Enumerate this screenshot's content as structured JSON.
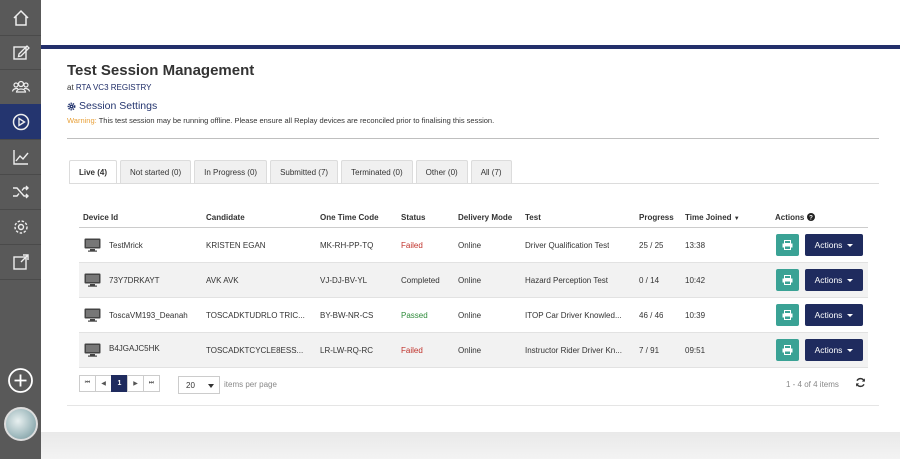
{
  "page": {
    "title": "Test Session Management",
    "subtitle_prefix": "at",
    "subtitle_registry": "RTA VC3 REGISTRY",
    "settings_label": "Session Settings",
    "warning_label": "Warning:",
    "warning_text": "This test session may be running offline. Please ensure all Replay devices are reconciled prior to finalising this session."
  },
  "sidebar": {
    "items": [
      {
        "icon": "home-icon"
      },
      {
        "icon": "edit-icon"
      },
      {
        "icon": "users-icon"
      },
      {
        "icon": "play-icon",
        "active": true
      },
      {
        "icon": "chart-icon"
      },
      {
        "icon": "shuffle-icon"
      },
      {
        "icon": "gear-icon"
      },
      {
        "icon": "external-link-icon"
      }
    ],
    "add_icon": "plus-circle-icon"
  },
  "tabs": [
    {
      "label": "Live (4)",
      "active": true
    },
    {
      "label": "Not started (0)"
    },
    {
      "label": "In Progress (0)"
    },
    {
      "label": "Submitted (7)"
    },
    {
      "label": "Terminated (0)"
    },
    {
      "label": "Other (0)"
    },
    {
      "label": "All (7)"
    }
  ],
  "table": {
    "headers": {
      "device": "Device Id",
      "candidate": "Candidate",
      "code": "One Time Code",
      "status": "Status",
      "mode": "Delivery Mode",
      "test": "Test",
      "progress": "Progress",
      "time": "Time Joined",
      "actions": "Actions"
    },
    "sort_indicator": "▼",
    "rows": [
      {
        "device": "TestMrick",
        "candidate": "KRISTEN EGAN",
        "code": "MK-RH-PP-TQ",
        "status": "Failed",
        "mode": "Online",
        "test": "Driver Qualification Test",
        "progress": "25 / 25",
        "time": "13:38",
        "actions": "Actions"
      },
      {
        "device": "73Y7DRKAYT",
        "candidate": "AVK AVK",
        "code": "VJ-DJ-BV-YL",
        "status": "Completed",
        "mode": "Online",
        "test": "Hazard Perception Test",
        "progress": "0 / 14",
        "time": "10:42",
        "actions": "Actions"
      },
      {
        "device": "ToscaVM193_Deanah",
        "candidate": "TOSCADKTUDRLO TRIC...",
        "code": "BY-BW-NR-CS",
        "status": "Passed",
        "mode": "Online",
        "test": "ITOP Car Driver Knowled...",
        "progress": "46 / 46",
        "time": "10:39",
        "actions": "Actions"
      },
      {
        "device": "B4JGAJC5HK",
        "candidate": "TOSCADKTCYCLE8ESS...",
        "code": "LR-LW-RQ-RC",
        "status": "Failed",
        "mode": "Online",
        "test": "Instructor Rider Driver Kn...",
        "progress": "7 / 91",
        "time": "09:51",
        "actions": "Actions"
      }
    ]
  },
  "pagination": {
    "first": "⏮",
    "prev": "◀",
    "current": "1",
    "next": "▶",
    "last": "⏭",
    "per_page": "20",
    "per_page_label": "items per page",
    "count_text": "1 - 4 of 4 items"
  },
  "colors": {
    "sidebar": "#595959",
    "accent_navy": "#1f2b5e",
    "print_button": "#3aa295",
    "status_failed": "#c0322b",
    "status_passed": "#2e8b3a",
    "warning": "#e8a13a"
  }
}
